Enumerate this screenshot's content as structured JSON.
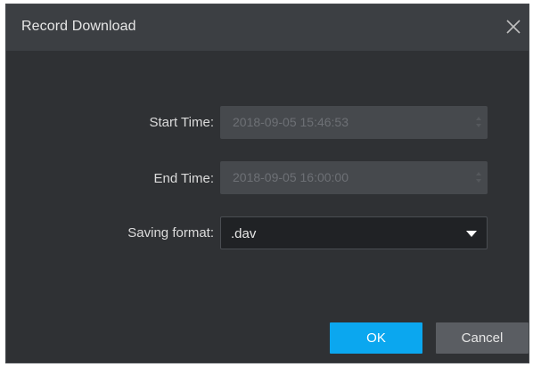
{
  "dialog": {
    "title": "Record Download",
    "close_icon": "close-icon"
  },
  "form": {
    "start_time_label": "Start Time:",
    "start_time_value": "2018-09-05 15:46:53",
    "end_time_label": "End Time:",
    "end_time_value": "2018-09-05 16:00:00",
    "saving_format_label": "Saving format:",
    "saving_format_value": ".dav"
  },
  "buttons": {
    "ok_label": "OK",
    "cancel_label": "Cancel"
  },
  "colors": {
    "dialog_bg": "#2f3134",
    "titlebar_bg": "#3c3f43",
    "accent": "#0ba7ef",
    "cancel_bg": "#5a5d62"
  }
}
